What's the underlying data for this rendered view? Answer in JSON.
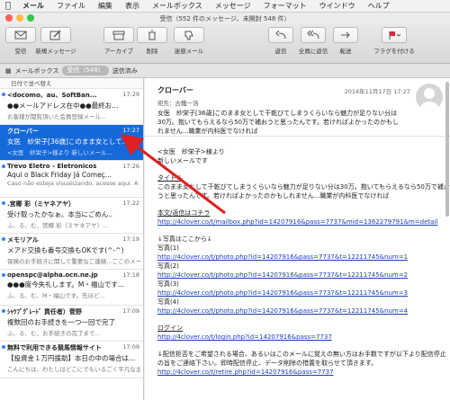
{
  "menu": [
    "メール",
    "ファイル",
    "編集",
    "表示",
    "メールボックス",
    "メッセージ",
    "フォーマット",
    "ウインドウ",
    "ヘルプ"
  ],
  "window": {
    "title": "受信（552 件のメッセージ、未開封 548 件）"
  },
  "toolbar": {
    "receive": "受信",
    "compose": "新規メッセージ",
    "archive": "アーカイブ",
    "delete": "削除",
    "junk": "迷惑メール",
    "reply": "返信",
    "reply_all": "全員に返信",
    "forward": "転送",
    "flag": "フラグを付ける"
  },
  "favorites": {
    "mailboxes": "メールボックス",
    "inbox": "受信（548）",
    "sent": "送信済み"
  },
  "list": {
    "sort": "日付で並べ替え",
    "messages": [
      {
        "from": "<docomo、au、SoftBan...",
        "time": "17:29",
        "subject": "●●メールアドレス在中●●最終お...",
        "preview": "お客様が閲覧頂いた会員登録メール..."
      },
      {
        "from": "クローバー",
        "time": "17:27",
        "subject": "女医　紗栄子[36歳]このまま女として...",
        "preview": "<女医　紗栄子>様より 新しいメール..."
      },
      {
        "from": "Trevo Eletro - Eletronicos",
        "time": "17:26",
        "subject": "Aqui o Black Friday Já Começ...",
        "preview": "Caso não esteja visualizando, acesse aqui. A loja virtual \"TREVO ELETRO..."
      },
      {
        "from": ".宮椰 彩（ミヤネアヤ）",
        "time": "17:22",
        "subject": "受け取ったかなぁ。本当にごめん..",
        "preview": "ふ、る、む、宮椰 彩（ミヤネアヤ）..."
      },
      {
        "from": "メモリアル",
        "time": "17:19",
        "subject": "メアド交換も番号交換もOKです(^-^)",
        "preview": "保険のお手続きに関して重要なご連絡…ここのメールには返信できません"
      },
      {
        "from": "openspc@alpha.ocn.ne.jp",
        "time": "17:18",
        "subject": "●●●度今失礼します。M・福山です...",
        "preview": "ふ、る、む、M・福山です。先ほど..."
      },
      {
        "from": "ｼｬﾂﾌﾟｸﾞﾚｰﾄﾞ 貢任者）菅野",
        "time": "17:09",
        "subject": "複数回のお手続きを一つ一回で完了",
        "preview": "ふ、る、む、お手続きの完了まで..."
      },
      {
        "from": "無料で利用できる競馬情報サイト",
        "time": "17:09",
        "subject": "【投資金１万円援助】本日の中の場合は...",
        "preview": "こんにちは、わたしはどこにでもいるごく平凡な主婦です"
      }
    ]
  },
  "reader": {
    "sender": "クローバー",
    "date": "2014年11月17日 17:27",
    "to_label": "宛先：",
    "to": "古鐵一浩",
    "header_text": "女医　紗栄子[36歳]このまま女として干乾びてしまうくらいなら魅力が足りない分は30万。抱いてもらえるなら50万で補おうと思ったんです。若ければよかったのかもしれません...職業が内科医でなければ",
    "body": [
      "<女医　紗栄子>様より",
      "新しいメールです",
      "",
      "タイトル",
      "このまま女として干乾びてしまうくらいなら魅力が足りない分は30万。抱いてもらえるなら50万で補おうと思ったんです。若ければよかったのかもしれません...職業が内科医でなければ",
      "",
      "本文/返信はコチラ",
      "http://4clover.co/t/mailbox.php?id=14207916&pass=7737&mid=1362279791&m=detail",
      "",
      "↓写真はここから↓",
      "写真(1)",
      "http://4clover.co/t/photo.php?id=14207916&pass=7737&t=12211745&num=1",
      "写真(2)",
      "http://4clover.co/t/photo.php?id=14207916&pass=7737&t=12211745&num=2",
      "写真(3)",
      "http://4clover.co/t/photo.php?id=14207916&pass=7737&t=12211745&num=3",
      "写真(4)",
      "http://4clover.co/t/photo.php?id=14207916&pass=7737&t=12211745&num=4",
      "",
      "ログイン",
      "http://4clover.co/t/login.php?id=14207916&pass=7737",
      "",
      "↓配信拒否をご希望される場合、あるいはこのメールに覚えの無い方はお手数ですが以下より配信停止の旨をご連絡下さい。即時配信停止、データ削除の措置を取らせて頂きます。",
      "http://4clover.co/t/retire.php?id=14207916&pass=7737"
    ]
  },
  "colors": {
    "selected": "#1669d8",
    "link": "#1a3fb8",
    "arrow": "#e02020"
  }
}
